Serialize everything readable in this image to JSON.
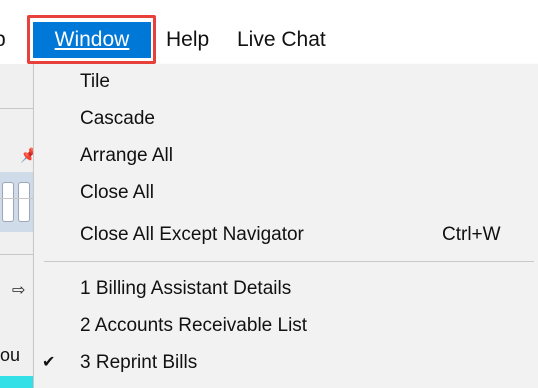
{
  "menubar": {
    "partial_item": "p",
    "window_label": "Window",
    "help_label": "Help",
    "livechat_label": "Live Chat"
  },
  "background": {
    "partial_text": "ou"
  },
  "window_menu": {
    "items": [
      {
        "label": "Tile",
        "shortcut": ""
      },
      {
        "label": "Cascade",
        "shortcut": ""
      },
      {
        "label": "Arrange All",
        "shortcut": ""
      },
      {
        "label": "Close All",
        "shortcut": ""
      },
      {
        "label": "Close All Except Navigator",
        "shortcut": "Ctrl+W"
      }
    ],
    "windows": [
      {
        "label": "1 Billing Assistant Details",
        "checked": false
      },
      {
        "label": "2 Accounts Receivable List",
        "checked": false
      },
      {
        "label": "3 Reprint Bills",
        "checked": true
      }
    ],
    "check_glyph": "✔"
  },
  "colors": {
    "selected_menu_bg": "#0078d7",
    "highlight_border": "#e8413b",
    "menu_bg": "#f2f2f2"
  }
}
